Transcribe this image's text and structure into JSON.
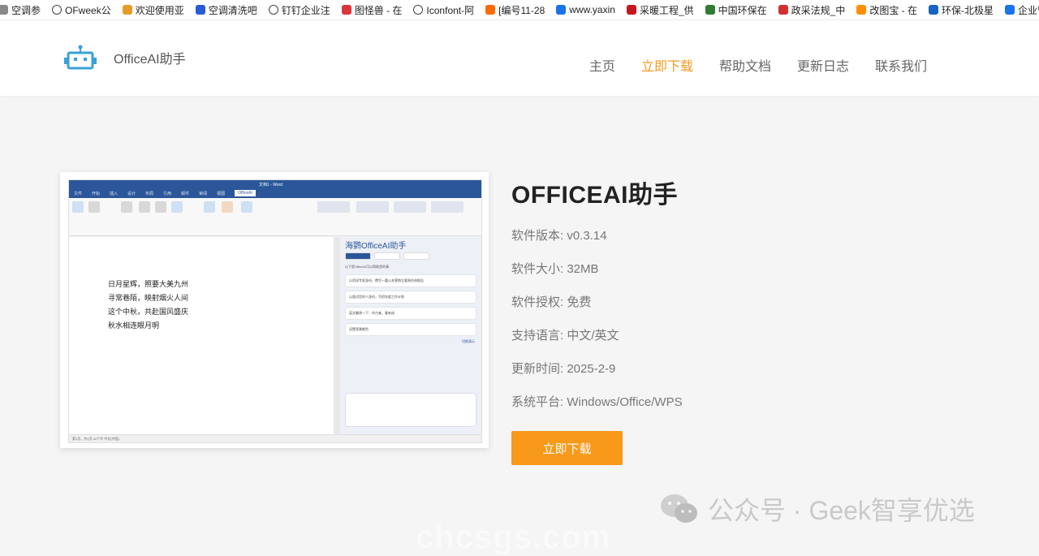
{
  "bookmarks": [
    {
      "label": "空调参",
      "icon": "tab-icon",
      "color": "#888888"
    },
    {
      "label": "OFweek公",
      "icon": "globe-icon",
      "color": "#444444"
    },
    {
      "label": "欢迎使用亚",
      "icon": "tab-icon",
      "color": "#e59b2a"
    },
    {
      "label": "空调清洗吧",
      "icon": "baidu-icon",
      "color": "#2a5bd7"
    },
    {
      "label": "钉钉企业注",
      "icon": "globe-icon",
      "color": "#444444"
    },
    {
      "label": "图怪兽 - 在",
      "icon": "image-icon",
      "color": "#d9363e"
    },
    {
      "label": "Iconfont-阿",
      "icon": "globe-icon",
      "color": "#444444"
    },
    {
      "label": "[编号11-28",
      "icon": "refresh-icon",
      "color": "#ff6a00"
    },
    {
      "label": "www.yaxin",
      "icon": "link-icon",
      "color": "#1a73e8"
    },
    {
      "label": "采暖工程_供",
      "icon": "flower-icon",
      "color": "#c4161c"
    },
    {
      "label": "中国环保在",
      "icon": "leaf-icon",
      "color": "#2e7d32"
    },
    {
      "label": "政采法规_中",
      "icon": "emblem-icon",
      "color": "#d32f2f"
    },
    {
      "label": "改图宝 - 在",
      "icon": "image-icon",
      "color": "#ff8f00"
    },
    {
      "label": "环保-北极星",
      "icon": "star-icon",
      "color": "#1565c0"
    },
    {
      "label": "企业管家",
      "icon": "link-icon",
      "color": "#1a73e8"
    }
  ],
  "header": {
    "logo_name": "OfficeAI助手",
    "nav": [
      {
        "label": "主页",
        "active": false
      },
      {
        "label": "立即下载",
        "active": true
      },
      {
        "label": "帮助文档",
        "active": false
      },
      {
        "label": "更新日志",
        "active": false
      },
      {
        "label": "联系我们",
        "active": false
      }
    ]
  },
  "screenshot": {
    "window_title": "文档1 - Word",
    "tabs": [
      "文件",
      "开始",
      "插入",
      "设计",
      "布局",
      "引用",
      "邮件",
      "审阅",
      "视图",
      "OfficeAI"
    ],
    "active_tab": "OfficeAI",
    "poem": [
      "日月星辉，照要大美九州",
      "寻常巷陌，映射烟火人间",
      "这个中秋，共赴国风盛庆",
      "秋水相连眼月明"
    ],
    "panel_title": "海鹦OfficeAI助手",
    "panel_subtitle": "以下是OfficeAI可以帮助您的事",
    "panel_items": [
      "以资深专家身份，撰写一篇公关营销主要责任体报告",
      "以面试官的人身份，写招年度工作计划",
      "英文翻译一下：作古者，春有成",
      "设置背景颜色"
    ],
    "panel_link": "切换演示",
    "status": "第1页，共1页  42个字  中文(中国)"
  },
  "product": {
    "title": "OFFICEAI助手",
    "version": "软件版本: v0.3.14",
    "size": "软件大小: 32MB",
    "license": "软件授权: 免费",
    "language": "支持语言: 中文/英文",
    "updated": "更新时间: 2025-2-9",
    "platform": "系统平台: Windows/Office/WPS"
  },
  "download_button": "立即下载",
  "watermark": "公众号 · Geek智享优选",
  "watermark_domain": "chcsgs.com",
  "colors": {
    "accent": "#f7991a",
    "nav_active": "#f39a1e",
    "logo_blue": "#3aa0d8",
    "word_blue": "#2b579a"
  }
}
